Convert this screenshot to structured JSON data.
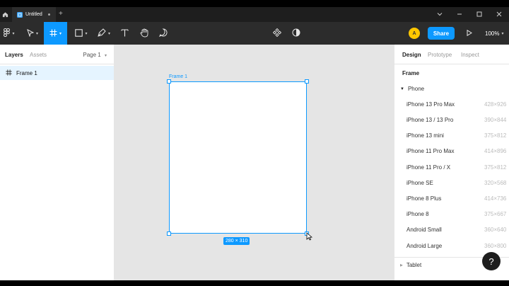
{
  "tab": {
    "title": "Untitled"
  },
  "toolbar": {
    "avatar_initial": "A",
    "share_label": "Share",
    "zoom": "100%"
  },
  "left_panel": {
    "tabs": [
      "Layers",
      "Assets"
    ],
    "page_selector": "Page 1",
    "layers": [
      {
        "name": "Frame 1"
      }
    ]
  },
  "canvas": {
    "frame_label": "Frame 1",
    "size_badge": "280 × 310"
  },
  "right_panel": {
    "tabs": [
      "Design",
      "Prototype",
      "Inspect"
    ],
    "section_title": "Frame",
    "group_label": "Phone",
    "presets": [
      {
        "name": "iPhone 13 Pro Max",
        "size": "428×926"
      },
      {
        "name": "iPhone 13 / 13 Pro",
        "size": "390×844"
      },
      {
        "name": "iPhone 13 mini",
        "size": "375×812"
      },
      {
        "name": "iPhone 11 Pro Max",
        "size": "414×896"
      },
      {
        "name": "iPhone 11 Pro / X",
        "size": "375×812"
      },
      {
        "name": "iPhone SE",
        "size": "320×568"
      },
      {
        "name": "iPhone 8 Plus",
        "size": "414×736"
      },
      {
        "name": "iPhone 8",
        "size": "375×667"
      },
      {
        "name": "Android Small",
        "size": "360×640"
      },
      {
        "name": "Android Large",
        "size": "360×800"
      }
    ],
    "tablet_label": "Tablet"
  },
  "help": {
    "label": "?"
  },
  "colors": {
    "accent": "#0d99ff",
    "toolbar_bg": "#2c2c2c",
    "avatar": "#ffc700"
  }
}
